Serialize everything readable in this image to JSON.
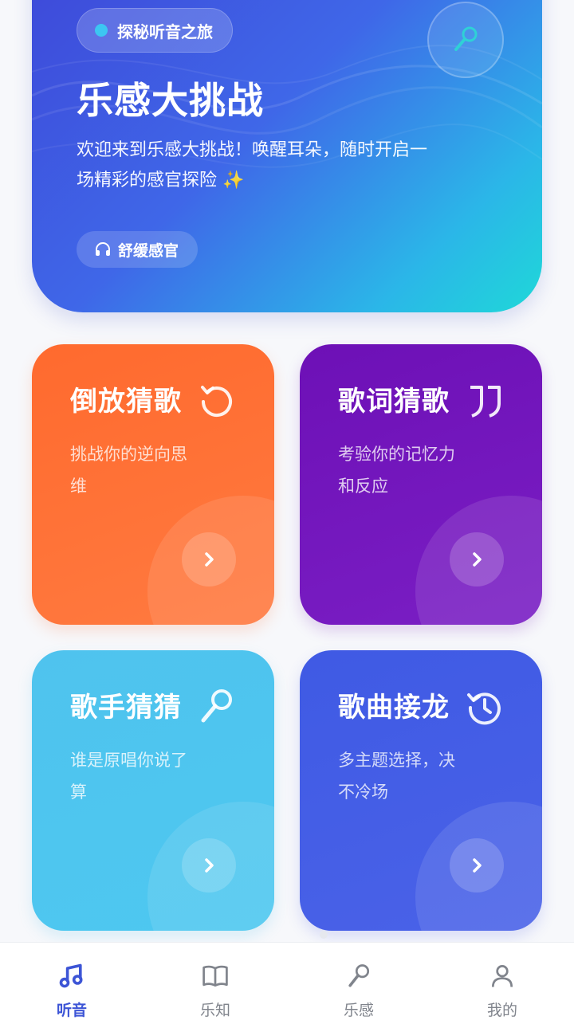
{
  "hero": {
    "badge": "探秘听音之旅",
    "title": "乐感大挑战",
    "description": "欢迎来到乐感大挑战！唤醒耳朵，随时开启一场精彩的感官探险 ✨",
    "tag": "舒缓感官",
    "tag_icon": "headphones-icon",
    "deco_icon": "microphone-icon"
  },
  "cards": [
    {
      "title": "倒放猜歌",
      "desc": "挑战你的逆向思维",
      "icon": "rewind-icon",
      "color": "#ff6a2e"
    },
    {
      "title": "歌词猜歌",
      "desc": "考验你的记忆力和反应",
      "icon": "quote-icon",
      "color": "#6d10b6"
    },
    {
      "title": "歌手猜猜",
      "desc": "谁是原唱你说了算",
      "icon": "microphone-icon",
      "color": "#4fc3ee"
    },
    {
      "title": "歌曲接龙",
      "desc": "多主题选择，决不冷场",
      "icon": "history-icon",
      "color": "#3f5ae4"
    }
  ],
  "nav": {
    "items": [
      {
        "label": "听音",
        "icon": "music-note-icon",
        "active": true
      },
      {
        "label": "乐知",
        "icon": "book-icon",
        "active": false
      },
      {
        "label": "乐感",
        "icon": "microphone-icon",
        "active": false
      },
      {
        "label": "我的",
        "icon": "user-icon",
        "active": false
      }
    ],
    "active_color": "#3d55d6",
    "inactive_color": "#80848c"
  }
}
